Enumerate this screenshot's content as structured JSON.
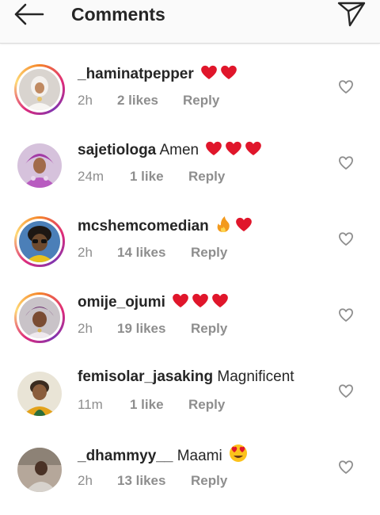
{
  "header": {
    "title": "Comments",
    "back_icon": "arrow-left-icon",
    "send_icon": "send-icon"
  },
  "comments": [
    {
      "username": "_haminatpepper",
      "text": "",
      "reactions": "heart heart",
      "time": "2h",
      "likes": "2 likes",
      "reply": "Reply"
    },
    {
      "username": "sajetiologa",
      "text": "Amen",
      "reactions": "heart heart heart",
      "time": "24m",
      "likes": "1 like",
      "reply": "Reply"
    },
    {
      "username": "mcshemcomedian",
      "text": "",
      "reactions": "fire heart",
      "time": "2h",
      "likes": "14 likes",
      "reply": "Reply"
    },
    {
      "username": "omije_ojumi",
      "text": "",
      "reactions": "heart heart heart",
      "time": "2h",
      "likes": "19 likes",
      "reply": "Reply"
    },
    {
      "username": "femisolar_jasaking",
      "text": "Magnificent ",
      "reactions": "",
      "time": "11m",
      "likes": "1 like",
      "reply": "Reply"
    },
    {
      "username": "_dhammyy__",
      "text": "Maami",
      "reactions": "heart-eyes",
      "time": "2h",
      "likes": "13 likes",
      "reply": "Reply"
    }
  ],
  "colors": {
    "heart": "#e0162b",
    "meta": "#8e8e8e",
    "text": "#262626"
  }
}
